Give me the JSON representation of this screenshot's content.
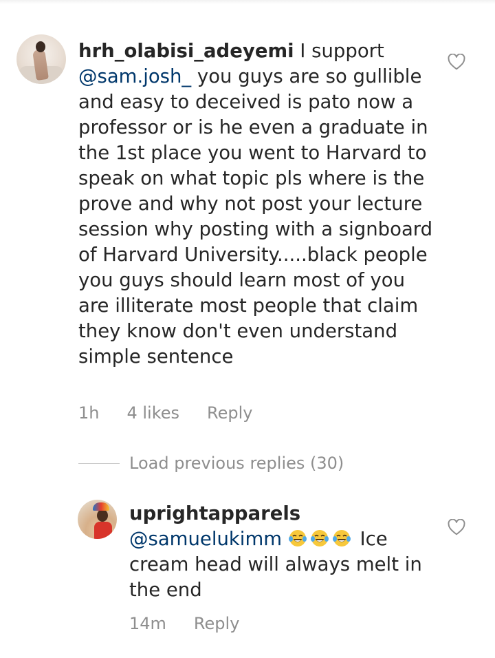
{
  "comments": [
    {
      "username": "hrh_olabisi_adeyemi",
      "text_before_mention": " I support ",
      "mention": "@sam.josh_",
      "text_after_mention": " you guys are so gullible and easy to deceived  is pato now a professor or is he even a graduate in the 1st place you went to Harvard to speak on what topic pls where is the prove and why not post  your lecture  session  why posting with a signboard of Harvard University.....black people you guys should learn most of you are illiterate most people that claim they know don't even understand simple sentence",
      "time": "1h",
      "likes": "4 likes",
      "reply_label": "Reply",
      "like_icon": "heart-outline-icon"
    }
  ],
  "load_previous": {
    "label": "Load previous replies (30)"
  },
  "reply": {
    "username": "uprightapparels",
    "mention": "@samuelukimm",
    "emojis": [
      "face-with-tears-of-joy",
      "face-with-tears-of-joy",
      "face-with-tears-of-joy"
    ],
    "text_after_emojis": " Ice cream head will always melt in the end",
    "time": "14m",
    "reply_label": "Reply",
    "like_icon": "heart-outline-icon"
  },
  "colors": {
    "text": "#262626",
    "mention": "#00376b",
    "muted": "#8e8e8e",
    "divider": "#c7c7c7"
  }
}
